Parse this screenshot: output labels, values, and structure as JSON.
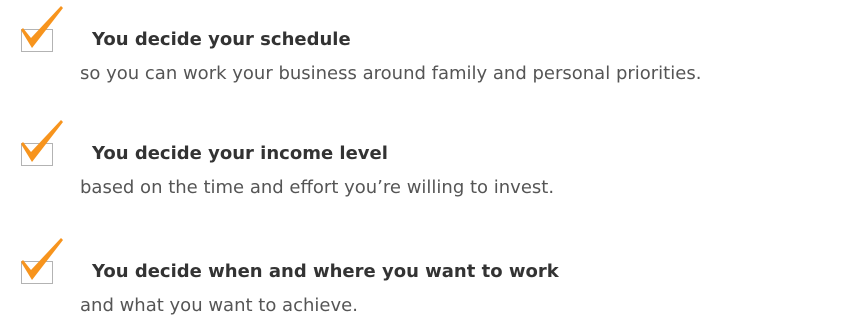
{
  "colors": {
    "check": "#f7941d",
    "title": "#333333",
    "description": "#555555",
    "checkbox_border": "#b3b3b3"
  },
  "icons": {
    "checkbox": "checkbox-icon",
    "checkmark": "checkmark-icon"
  },
  "items": [
    {
      "title": "You decide your schedule",
      "description": "so you can work your business around family and personal priorities."
    },
    {
      "title": "You decide your income level",
      "description": "based on the time and effort you’re willing to invest."
    },
    {
      "title": "You decide when and where you want to work",
      "description": "and what you want to achieve."
    }
  ]
}
